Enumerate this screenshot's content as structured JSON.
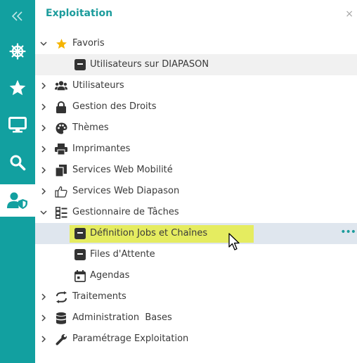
{
  "panel": {
    "title": "Exploitation",
    "close_glyph": "×"
  },
  "sidebar": {
    "collapse_icon": "double-chevron-left-icon",
    "items": [
      {
        "icon": "ship-wheel-icon"
      },
      {
        "icon": "star-icon"
      },
      {
        "icon": "monitor-icon"
      },
      {
        "icon": "search-icon"
      },
      {
        "icon": "user-shield-icon",
        "active": true
      }
    ]
  },
  "tree": {
    "favoris": {
      "label": "Favoris",
      "icon": "star-icon",
      "children": [
        {
          "label": "Utilisateurs sur DIAPASON",
          "icon": "window-icon"
        }
      ]
    },
    "utilisateurs": {
      "label": "Utilisateurs",
      "icon": "users-icon"
    },
    "gestion_droits": {
      "label": "Gestion des Droits",
      "icon": "lock-icon"
    },
    "themes": {
      "label": "Thèmes",
      "icon": "palette-icon"
    },
    "imprimantes": {
      "label": "Imprimantes",
      "icon": "printer-icon"
    },
    "ws_mobilite": {
      "label": "Services Web Mobilité",
      "icon": "copy-icon"
    },
    "ws_diapason": {
      "label": "Services Web Diapason",
      "icon": "thumbs-up-icon"
    },
    "gestionnaire": {
      "label": "Gestionnaire de Tâches",
      "icon": "task-list-icon",
      "children": [
        {
          "label": "Définition Jobs et Chaînes",
          "icon": "window-icon",
          "highlight_color": "#e5ec60"
        },
        {
          "label": "Files d'Attente",
          "icon": "window-icon"
        },
        {
          "label": "Agendas",
          "icon": "calendar-icon"
        }
      ],
      "row_menu": "•••"
    },
    "traitements": {
      "label": "Traitements",
      "icon": "sync-icon"
    },
    "admin_bases": {
      "label": "Administration  Bases",
      "icon": "database-icon"
    },
    "param": {
      "label": "Paramétrage Exploitation",
      "icon": "wrench-icon"
    }
  },
  "colors": {
    "accent": "#12a0a0",
    "title": "#1c9c9c",
    "highlight": "#e5ec60",
    "selected_row": "#dfe6ee"
  }
}
